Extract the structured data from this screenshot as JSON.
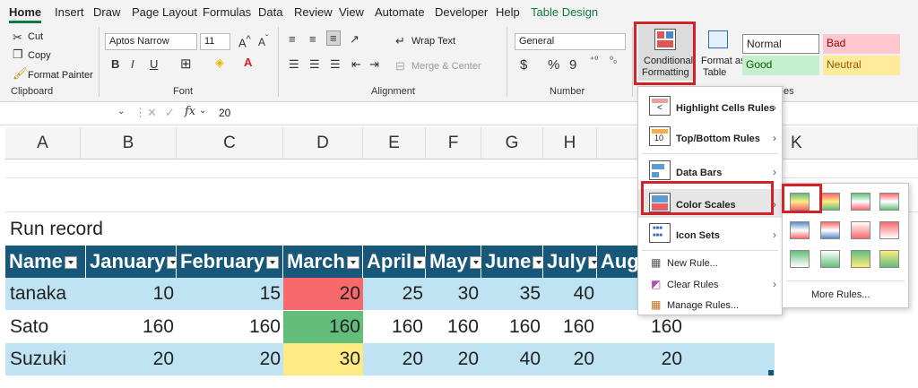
{
  "tabs": [
    "Home",
    "Insert",
    "Draw",
    "Page Layout",
    "Formulas",
    "Data",
    "Review",
    "View",
    "Automate",
    "Developer",
    "Help",
    "Table Design"
  ],
  "clipboard": {
    "cut": "Cut",
    "copy": "Copy",
    "format_painter": "Format Painter",
    "label": "Clipboard"
  },
  "font": {
    "name": "Aptos Narrow",
    "size": "11",
    "label": "Font",
    "bold": "B",
    "italic": "I",
    "underline": "U"
  },
  "alignment": {
    "wrap_text": "Wrap Text",
    "merge_center": "Merge & Center",
    "label": "Alignment"
  },
  "number": {
    "format": "General",
    "label": "Number",
    "currency": "$",
    "percent": "%",
    "comma": "9"
  },
  "styles": {
    "cond_format": "Conditional Formatting",
    "cond_format_line1": "Conditional",
    "cond_format_line2": "Formatting",
    "format_table_line1": "Format as",
    "format_table_line2": "Table",
    "normal": "Normal",
    "bad": "Bad",
    "good": "Good",
    "neutral": "Neutral",
    "label_tail": "es"
  },
  "formula_bar": {
    "fx": "fx",
    "value": "20"
  },
  "columns": [
    "A",
    "B",
    "C",
    "D",
    "E",
    "F",
    "G",
    "H",
    "K"
  ],
  "sheet": {
    "title": "Run record",
    "headers": [
      "Name",
      "January",
      "February",
      "March",
      "April",
      "May",
      "June",
      "July",
      "Aug"
    ],
    "rows": [
      {
        "name": "tanaka",
        "values": [
          "10",
          "15",
          "20",
          "25",
          "30",
          "35",
          "40",
          ""
        ]
      },
      {
        "name": "Sato",
        "values": [
          "160",
          "160",
          "160",
          "160",
          "160",
          "160",
          "160",
          "160"
        ]
      },
      {
        "name": "Suzuki",
        "values": [
          "20",
          "20",
          "30",
          "20",
          "20",
          "40",
          "20",
          "20"
        ]
      }
    ]
  },
  "menu": {
    "items": [
      "Highlight Cells Rules",
      "Top/Bottom Rules",
      "Data Bars",
      "Color Scales",
      "Icon Sets",
      "New Rule...",
      "Clear Rules",
      "Manage Rules..."
    ]
  },
  "submenu": {
    "more_rules": "More Rules..."
  },
  "colors": {
    "accent": "#0e7a3e",
    "table_header": "#17587a",
    "row_band": "#bfe3f3",
    "red": "#f8696b",
    "green": "#63be7b",
    "yellow": "#ffeb84",
    "highlight": "#d2232a"
  }
}
